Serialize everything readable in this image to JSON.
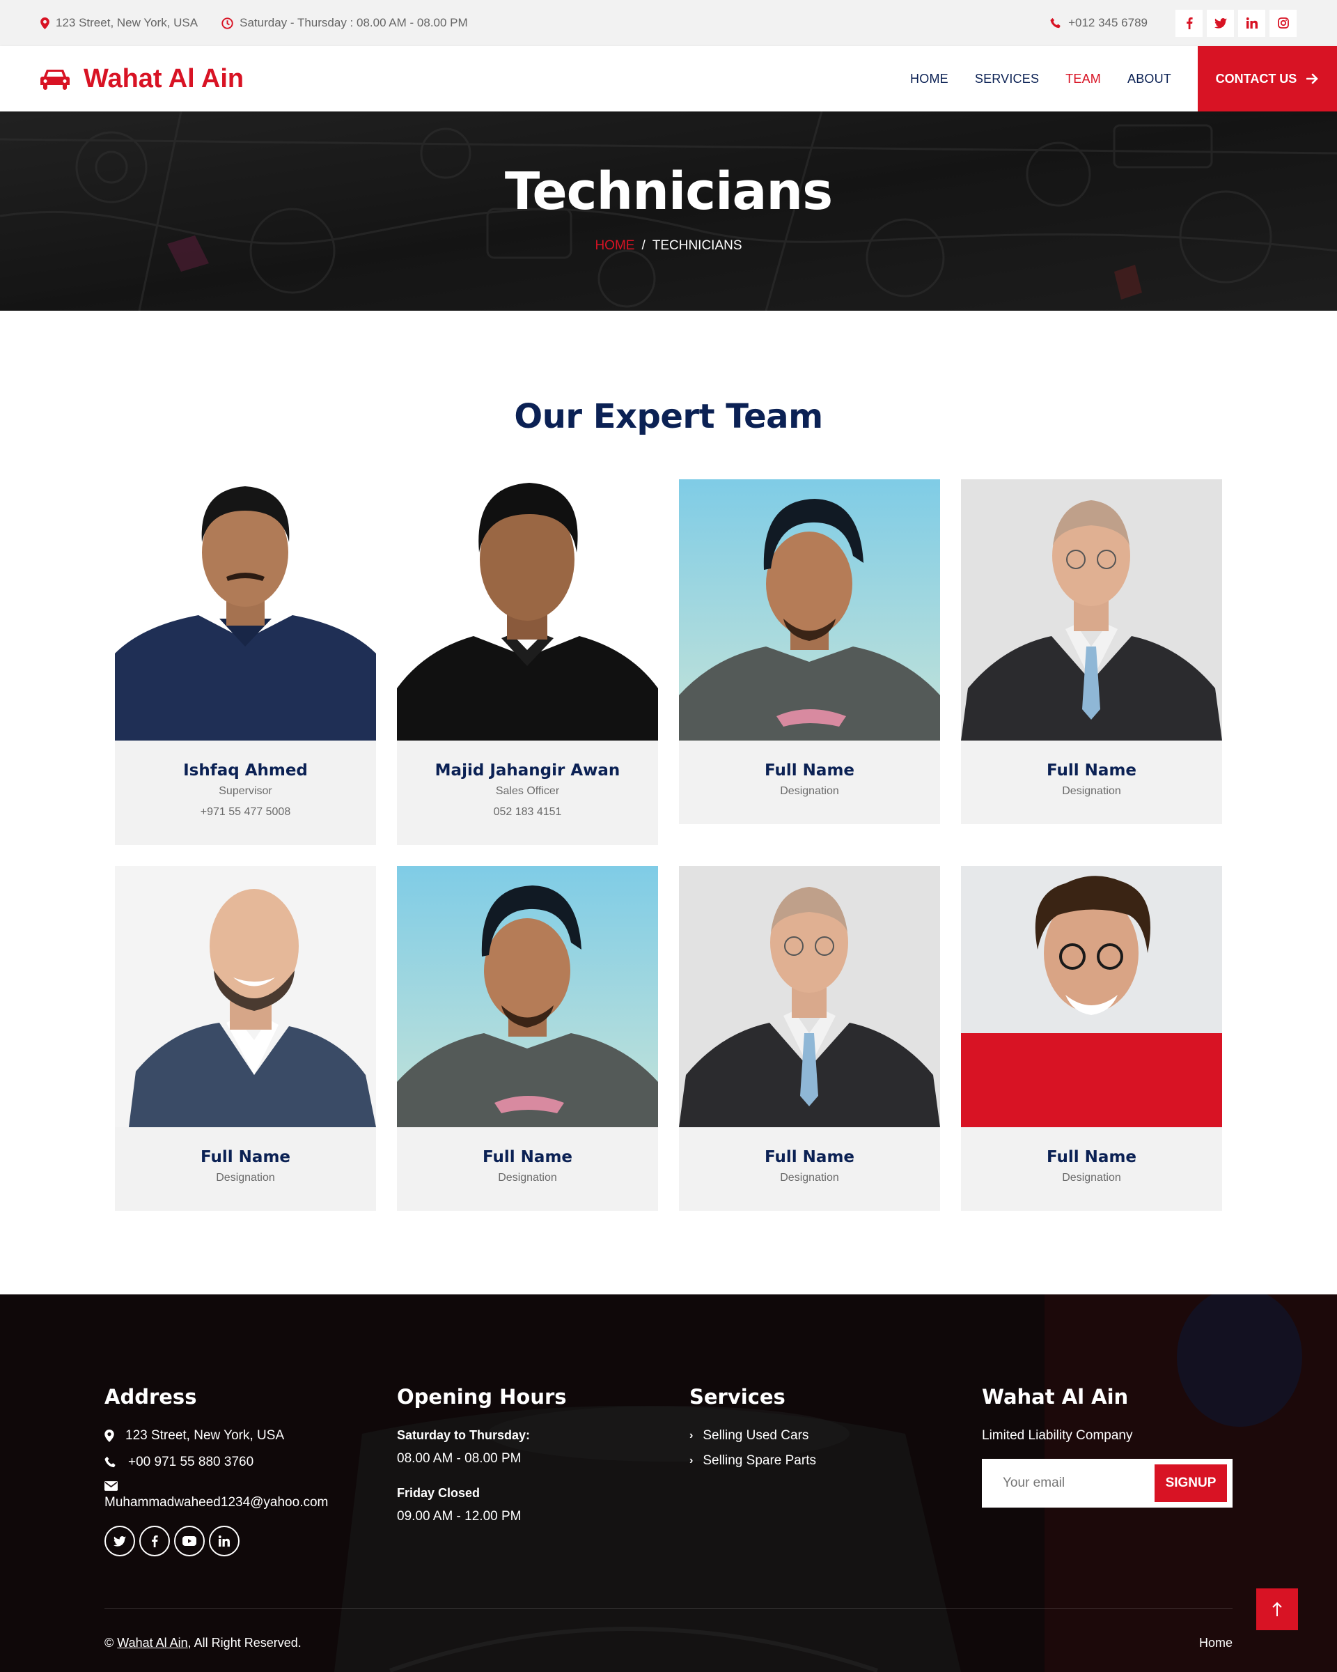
{
  "topbar": {
    "address": "123 Street, New York, USA",
    "hours": "Saturday - Thursday : 08.00 AM - 08.00 PM",
    "phone": "+012 345 6789",
    "socials": [
      {
        "icon": "facebook-icon",
        "glyph": "f"
      },
      {
        "icon": "twitter-icon",
        "glyph": "t"
      },
      {
        "icon": "linkedin-icon",
        "glyph": "in"
      },
      {
        "icon": "instagram-icon",
        "glyph": "ig"
      }
    ]
  },
  "navbar": {
    "brand": "Wahat Al Ain",
    "links": [
      "HOME",
      "SERVICES",
      "TEAM",
      "ABOUT"
    ],
    "active": "TEAM",
    "contact_label": "CONTACT US"
  },
  "hero": {
    "title": "Technicians",
    "breadcrumb_home": "HOME",
    "breadcrumb_separator": "/",
    "breadcrumb_current": "TECHNICIANS"
  },
  "team": {
    "heading": "Our Expert Team",
    "members": [
      {
        "name": "Ishfaq Ahmed",
        "role": "Supervisor",
        "phone": "+971 55 477 5008"
      },
      {
        "name": "Majid Jahangir Awan",
        "role": "Sales Officer",
        "phone": "052 183 4151"
      },
      {
        "name": "Full Name",
        "role": "Designation"
      },
      {
        "name": "Full Name",
        "role": "Designation"
      },
      {
        "name": "Full Name",
        "role": "Designation"
      },
      {
        "name": "Full Name",
        "role": "Designation"
      },
      {
        "name": "Full Name",
        "role": "Designation"
      },
      {
        "name": "Full Name",
        "role": "Designation"
      }
    ]
  },
  "footer": {
    "address_heading": "Address",
    "address": "123 Street, New York, USA",
    "phone": "+00 971 55 880 3760",
    "email": "Muhammadwaheed1234@yahoo.com",
    "hours_heading": "Opening Hours",
    "hours_days": "Saturday to Thursday:",
    "hours_time": "08.00 AM - 08.00 PM",
    "friday_label": "Friday Closed",
    "friday_time": "09.00 AM - 12.00 PM",
    "services_heading": "Services",
    "services": [
      "Selling Used Cars",
      "Selling Spare Parts"
    ],
    "company_heading": "Wahat Al Ain",
    "company_tag": "Limited Liability Company",
    "email_placeholder": "Your email",
    "signup_label": "SIGNUP",
    "copyright_symbol": "©",
    "copyright_link": "Wahat Al Ain",
    "copyright_text": ", All Right Reserved.",
    "bottom_link": "Home"
  },
  "colors": {
    "accent": "#d81324",
    "navy": "#0b2154",
    "card_bg": "#f2f2f2",
    "topbar_bg": "#f2f2f2"
  }
}
